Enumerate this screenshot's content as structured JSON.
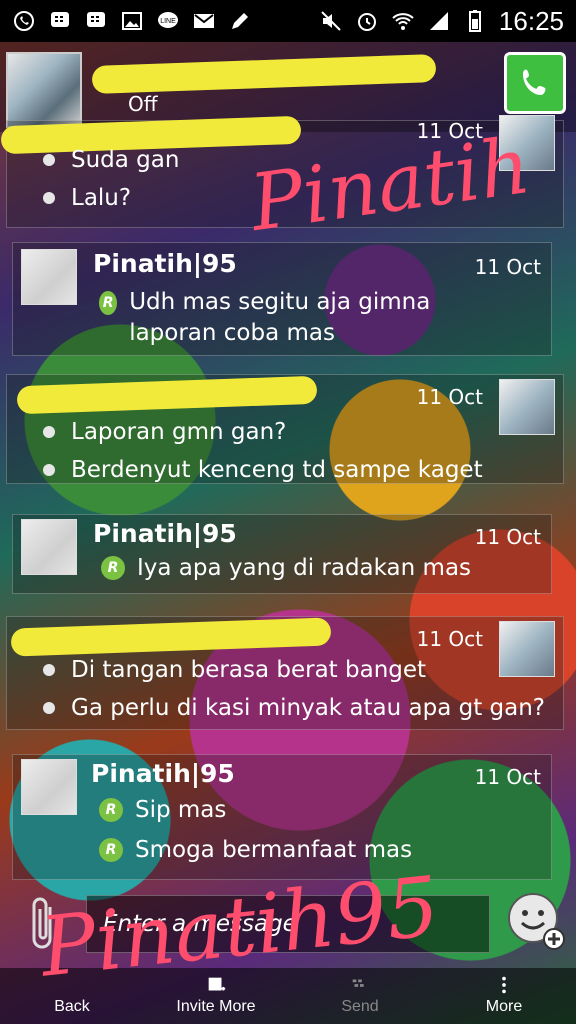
{
  "status_bar": {
    "time": "16:25"
  },
  "header": {
    "contact_status": "Off"
  },
  "messages": [
    {
      "type": "out",
      "date": "11 Oct",
      "lines": [
        "Suda gan",
        "Lalu?"
      ]
    },
    {
      "type": "in",
      "name": "Pinatih|95",
      "date": "11 Oct",
      "lines": [
        "Udh mas segitu aja gimna laporan coba mas"
      ]
    },
    {
      "type": "out",
      "date": "11 Oct",
      "lines": [
        "Laporan gmn gan?",
        "Berdenyut kenceng td sampe kaget"
      ]
    },
    {
      "type": "in",
      "name": "Pinatih|95",
      "date": "11 Oct",
      "lines": [
        "Iya apa yang di radakan mas"
      ]
    },
    {
      "type": "out",
      "date": "11 Oct",
      "lines": [
        "Di tangan berasa berat banget",
        "Ga perlu di kasi minyak atau apa gt gan?"
      ]
    },
    {
      "type": "in",
      "name": "Pinatih|95",
      "date": "11 Oct",
      "lines": [
        "Sip mas",
        "Smoga bermanfaat mas"
      ]
    }
  ],
  "read_mark": "R",
  "composer": {
    "placeholder": "Enter a message"
  },
  "bottom_bar": {
    "back": "Back",
    "invite_more": "Invite More",
    "send": "Send",
    "more": "More"
  },
  "watermark": {
    "top": "Pinatih",
    "bottom": "Pinatih95"
  }
}
